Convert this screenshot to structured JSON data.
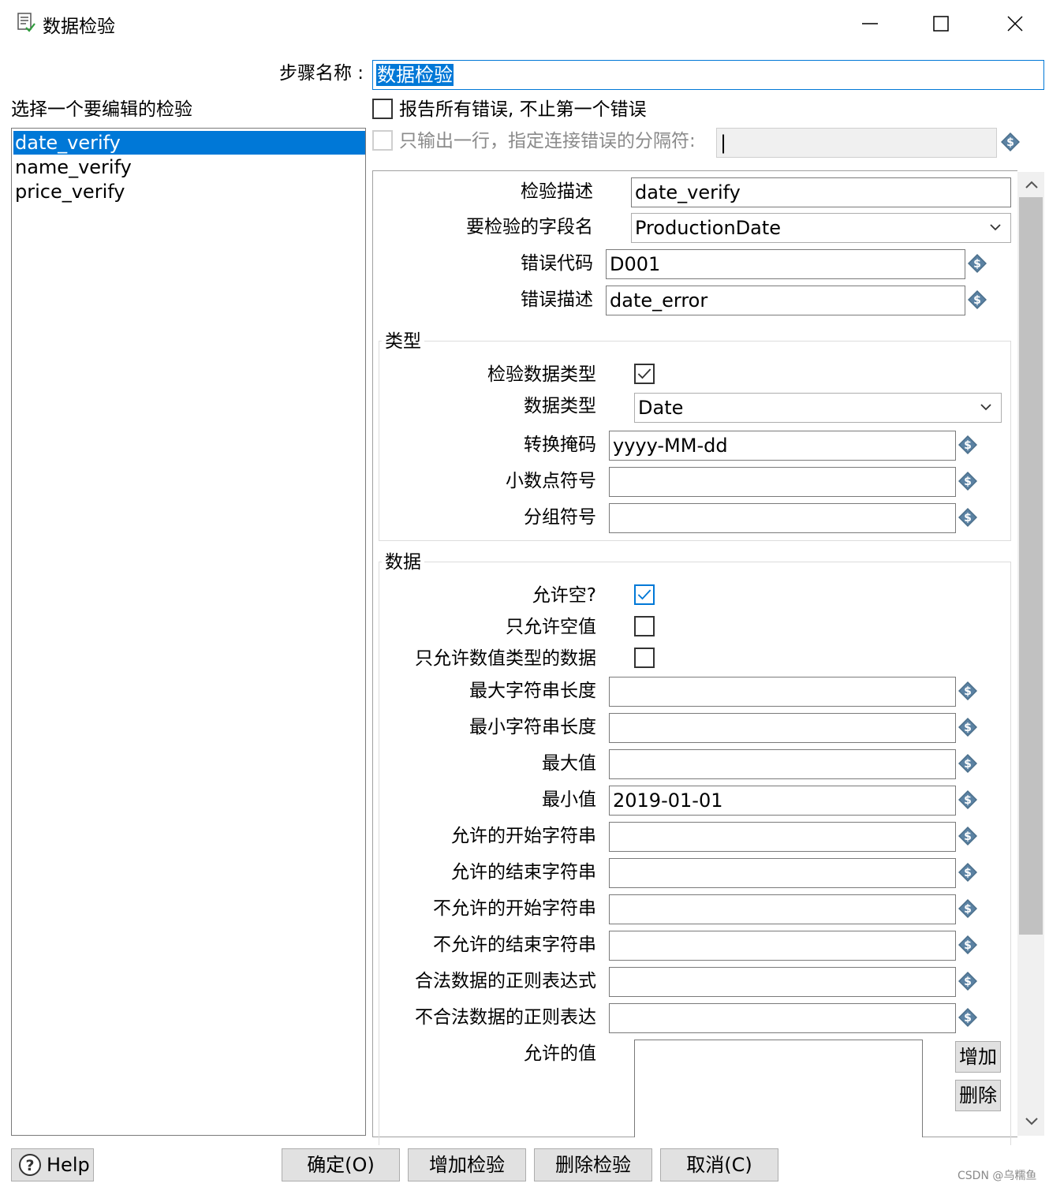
{
  "window": {
    "title": "数据检验",
    "minimize_glyph": "—",
    "maximize_glyph": "☐",
    "close_glyph": "✕"
  },
  "step_name": {
    "label": "步骤名称 :",
    "value": "数据检验"
  },
  "list_header": "选择一个要编辑的检验",
  "validations": [
    "date_verify",
    "name_verify",
    "price_verify"
  ],
  "options": {
    "report_all_errors": "报告所有错误, 不止第一个错误",
    "single_row": "只输出一行，指定连接错误的分隔符:",
    "separator_value": "|"
  },
  "details": {
    "description_label": "检验描述",
    "description_value": "date_verify",
    "field_label": "要检验的字段名",
    "field_value": "ProductionDate",
    "error_code_label": "错误代码",
    "error_code_value": "D001",
    "error_desc_label": "错误描述",
    "error_desc_value": "date_error"
  },
  "type_group": {
    "title": "类型",
    "check_type_label": "检验数据类型",
    "data_type_label": "数据类型",
    "data_type_value": "Date",
    "mask_label": "转换掩码",
    "mask_value": "yyyy-MM-dd",
    "decimal_label": "小数点符号",
    "grouping_label": "分组符号"
  },
  "data_group": {
    "title": "数据",
    "allow_null_label": "允许空?",
    "only_null_label": "只允许空值",
    "only_numeric_label": "只允许数值类型的数据",
    "max_len_label": "最大字符串长度",
    "min_len_label": "最小字符串长度",
    "max_val_label": "最大值",
    "min_val_label": "最小值",
    "min_val_value": "2019-01-01",
    "start_allowed_label": "允许的开始字符串",
    "end_allowed_label": "允许的结束字符串",
    "start_disallowed_label": "不允许的开始字符串",
    "end_disallowed_label": "不允许的结束字符串",
    "regex_valid_label": "合法数据的正则表达式",
    "regex_invalid_label": "不合法数据的正则表达",
    "allowed_values_label": "允许的值",
    "add_label": "增加",
    "delete_label": "删除"
  },
  "footer": {
    "help": "Help",
    "ok": "确定(O)",
    "add_validation": "增加检验",
    "remove_validation": "删除检验",
    "cancel": "取消(C)"
  },
  "watermark": "CSDN @乌糯鱼",
  "colors": {
    "selection": "#0078d7",
    "var_icon": "#4a6e8a"
  }
}
